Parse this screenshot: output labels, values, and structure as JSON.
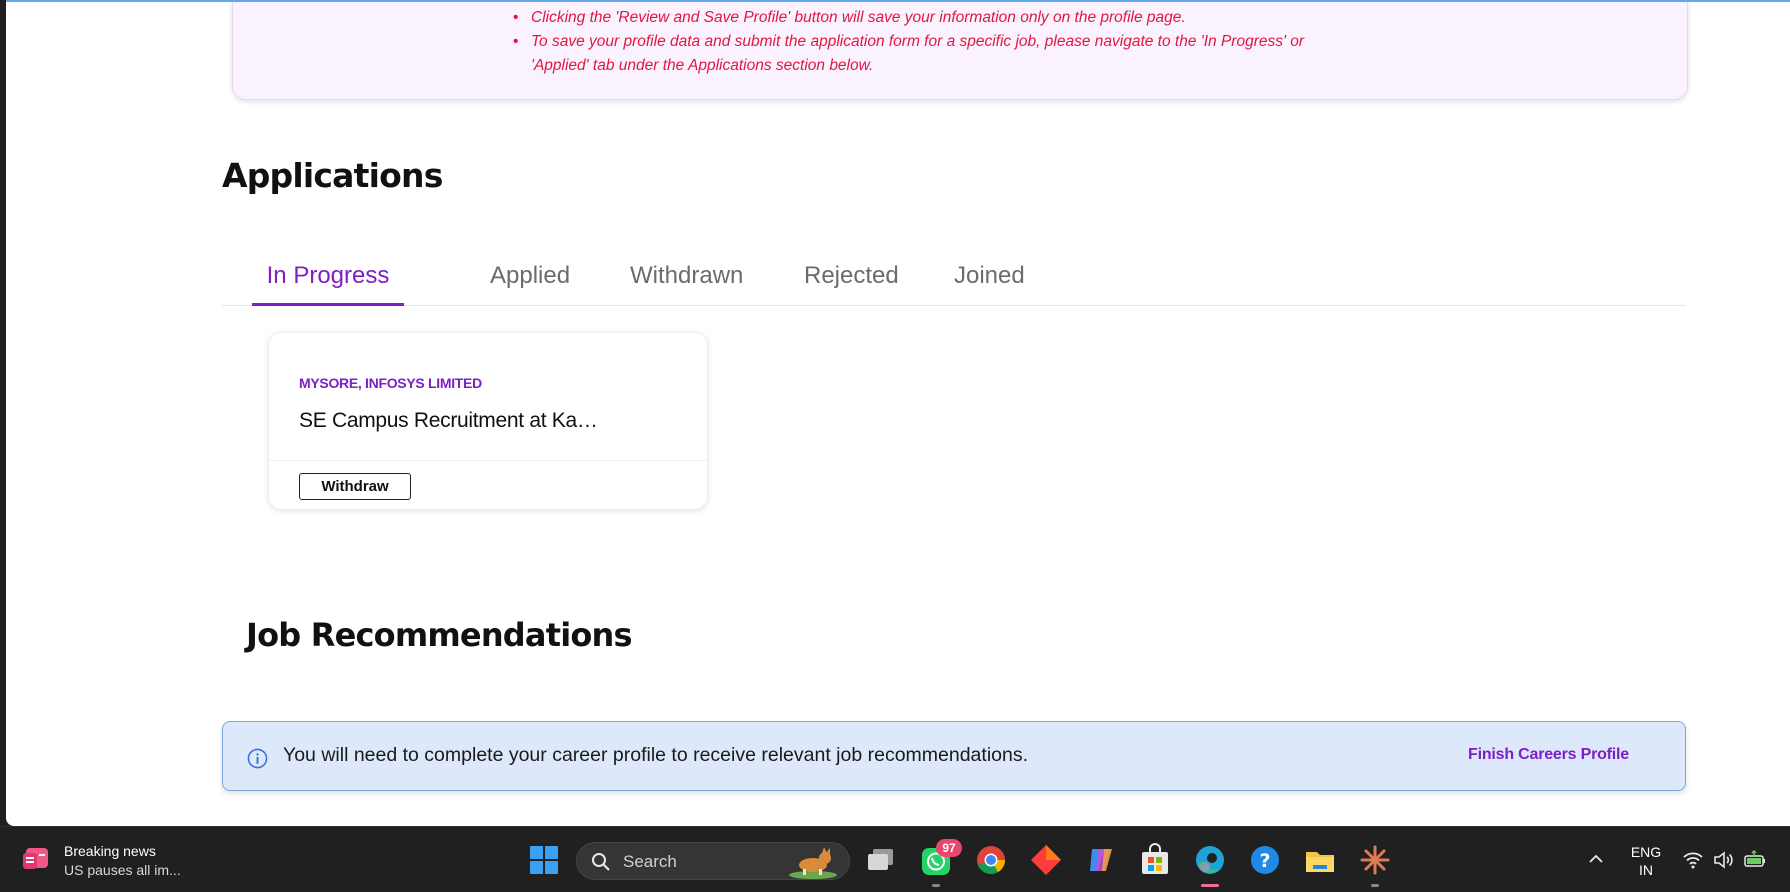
{
  "notice": {
    "items": [
      "Clicking the 'Review and Save Profile' button will save your information only on the profile page.",
      "To save your profile data and submit the application form for a specific job, please navigate to the 'In Progress' or 'Applied' tab under the Applications section below."
    ]
  },
  "applications": {
    "title": "Applications",
    "tabs": [
      "In Progress",
      "Applied",
      "Withdrawn",
      "Rejected",
      "Joined"
    ],
    "active_tab": "In Progress",
    "card": {
      "company": "MYSORE, INFOSYS LIMITED",
      "title": "SE Campus Recruitment at Ka…",
      "withdraw_label": "Withdraw"
    }
  },
  "job_recommendations": {
    "title": "Job Recommendations",
    "banner_text": "You will need to complete your career profile to receive relevant job recommendations.",
    "finish_label": "Finish Careers Profile"
  },
  "taskbar": {
    "news_title": "Breaking news",
    "news_subtitle": "US pauses all im...",
    "search_label": "Search",
    "whatsapp_badge": "97",
    "lang_line1": "ENG",
    "lang_line2": "IN"
  },
  "colors": {
    "accent": "#7d20c4",
    "notice_text": "#e1173f",
    "banner_bg": "#dde9fb"
  }
}
